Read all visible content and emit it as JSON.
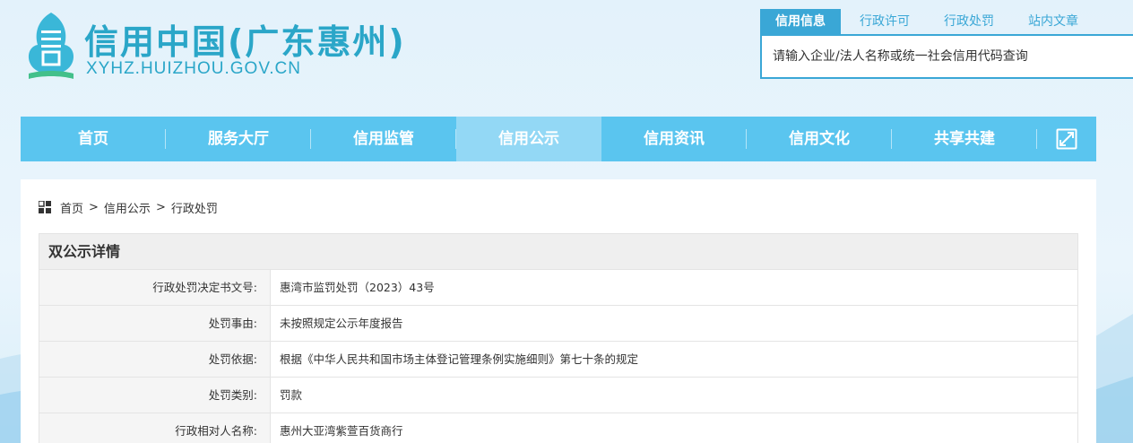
{
  "header": {
    "logo_title": "信用中国(广东惠州)",
    "logo_domain": "XYHZ.HUIZHOU.GOV.CN"
  },
  "search": {
    "tabs": [
      {
        "label": "信用信息",
        "active": true
      },
      {
        "label": "行政许可",
        "active": false
      },
      {
        "label": "行政处罚",
        "active": false
      },
      {
        "label": "站内文章",
        "active": false
      }
    ],
    "placeholder": "请输入企业/法人名称或统一社会信用代码查询"
  },
  "nav": {
    "items": [
      {
        "label": "首页"
      },
      {
        "label": "服务大厅"
      },
      {
        "label": "信用监管"
      },
      {
        "label": "信用公示",
        "active": true
      },
      {
        "label": "信用资讯"
      },
      {
        "label": "信用文化"
      },
      {
        "label": "共享共建"
      }
    ],
    "expand_icon": "expand-icon"
  },
  "breadcrumb": {
    "icon": "grid-icon",
    "items": [
      "首页",
      "信用公示",
      "行政处罚"
    ],
    "separator": ">"
  },
  "detail": {
    "title": "双公示详情",
    "rows": [
      {
        "label": "行政处罚决定书文号:",
        "value": "惠湾市监罚处罚（2023）43号"
      },
      {
        "label": "处罚事由:",
        "value": "未按照规定公示年度报告"
      },
      {
        "label": "处罚依据:",
        "value": "根据《中华人民共和国市场主体登记管理条例实施细则》第七十条的规定"
      },
      {
        "label": "处罚类别:",
        "value": "罚款"
      },
      {
        "label": "行政相对人名称:",
        "value": "惠州大亚湾紫萱百货商行"
      }
    ]
  },
  "colors": {
    "nav_bg": "#5ac5ef",
    "nav_active": "#93d8f5",
    "accent": "#3aa7d6",
    "logo": "#2aa6c8"
  }
}
